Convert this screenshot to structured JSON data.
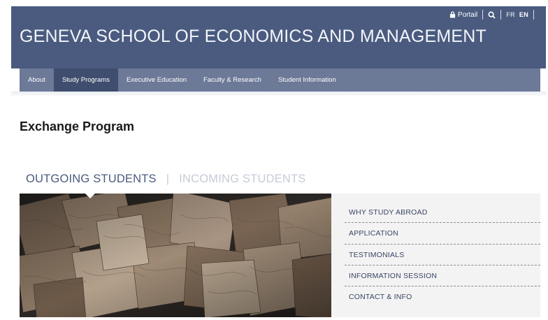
{
  "header": {
    "site_title": "GENEVA SCHOOL OF ECONOMICS AND MANAGEMENT",
    "utility": {
      "portal_label": "Portail",
      "lang_fr": "FR",
      "lang_en": "EN"
    }
  },
  "nav": {
    "items": [
      {
        "label": "About"
      },
      {
        "label": "Study Programs",
        "active": true
      },
      {
        "label": "Executive Education"
      },
      {
        "label": "Faculty & Research"
      },
      {
        "label": "Student Information"
      }
    ]
  },
  "main": {
    "page_title": "Exchange Program",
    "tabs": [
      {
        "label": "OUTGOING STUDENTS",
        "active": true
      },
      {
        "label": "INCOMING STUDENTS",
        "active": false
      }
    ],
    "tab_separator": "|",
    "side_menu": [
      {
        "label": "WHY STUDY ABROAD"
      },
      {
        "label": "APPLICATION"
      },
      {
        "label": "TESTIMONIALS"
      },
      {
        "label": "INFORMATION SESSION"
      },
      {
        "label": "CONTACT & INFO"
      }
    ]
  },
  "colors": {
    "header_bg": "#4a5b7f",
    "nav_bg": "#6c7997",
    "nav_active_bg": "#3f4d6e",
    "tab_active": "#4b5b7c",
    "tab_inactive": "#c6cbd6",
    "side_bg": "#f3f3f3"
  },
  "icons": {
    "lock": "lock-icon",
    "search": "search-icon"
  }
}
